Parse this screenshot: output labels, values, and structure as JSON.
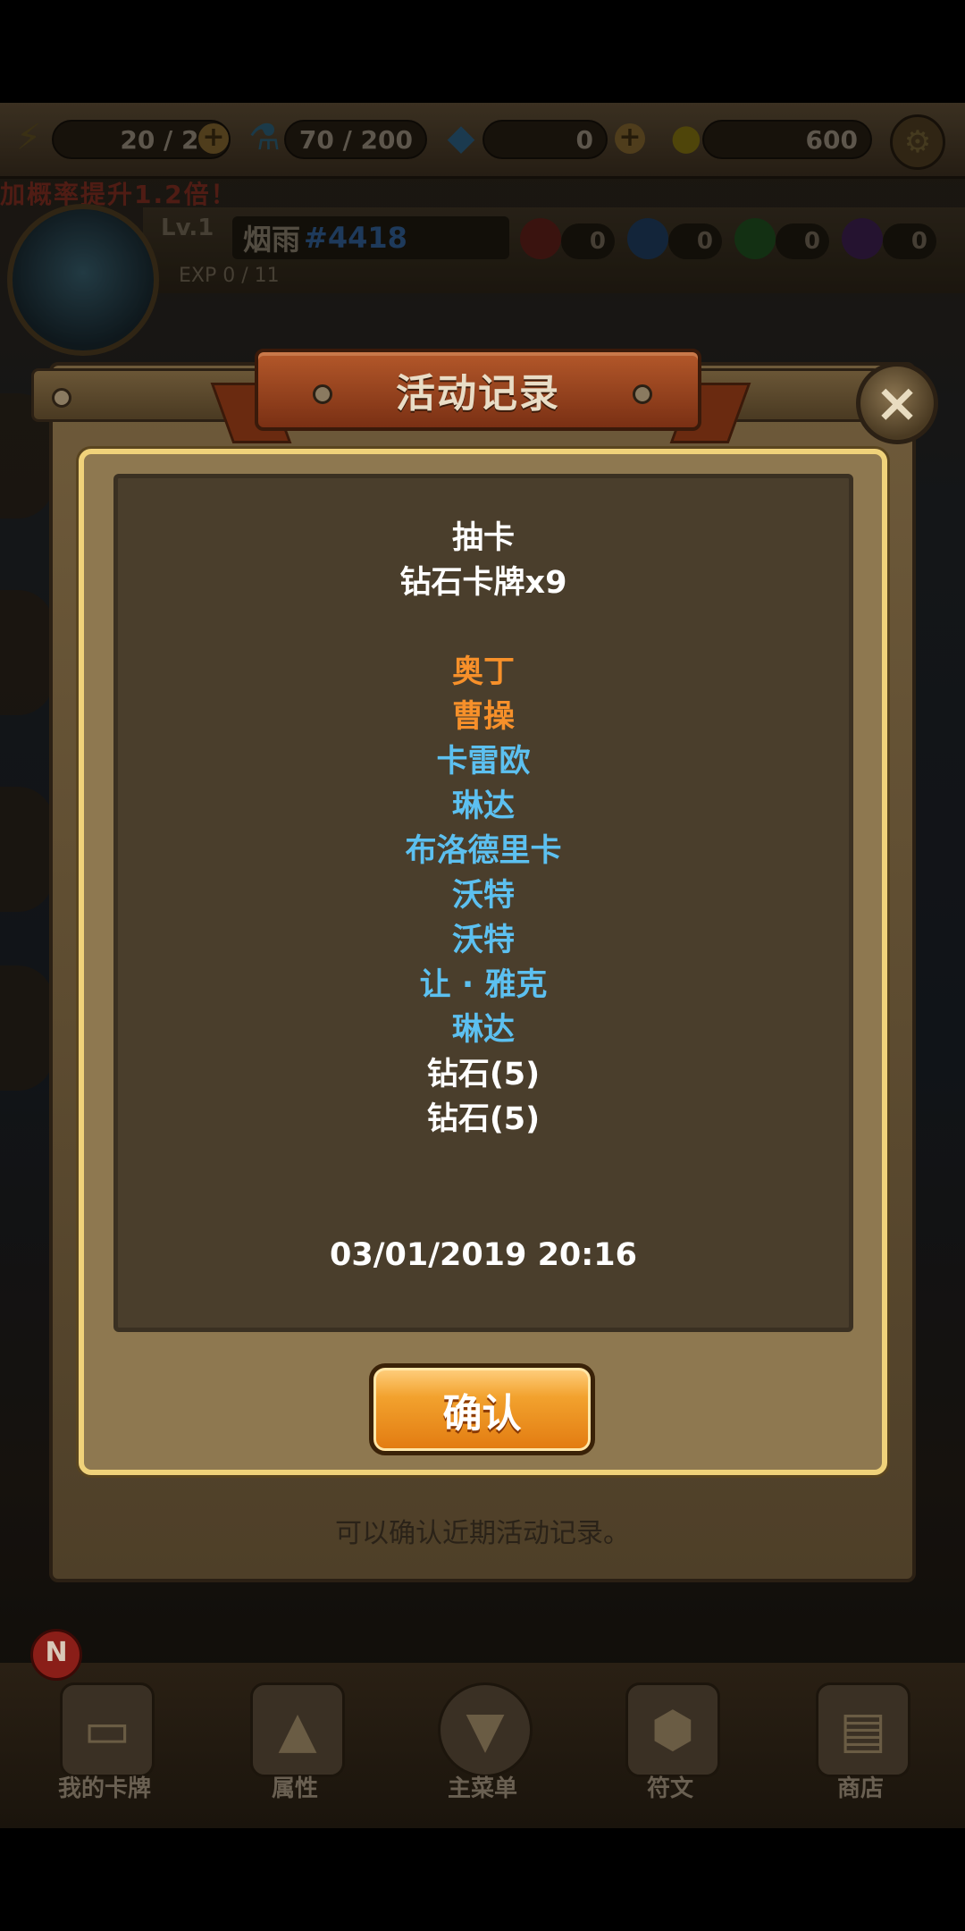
{
  "status": {
    "energy": "20 / 20",
    "potion": "70 / 200",
    "diamonds": "0",
    "gold": "600"
  },
  "banner": "加概率提升1.2倍！",
  "profile": {
    "level": "Lv.1",
    "exp": "EXP  0 / 11",
    "name": "烟雨",
    "tag": "#4418",
    "orbs": [
      {
        "color": "#b8332a",
        "value": "0"
      },
      {
        "color": "#3a78c8",
        "value": "0"
      },
      {
        "color": "#3aa83a",
        "value": "0"
      },
      {
        "color": "#8a3ab8",
        "value": "0"
      }
    ]
  },
  "dialog": {
    "title": "活动记录",
    "close_icon": "×",
    "record": {
      "type": "抽卡",
      "pack": "钻石卡牌x9",
      "items": [
        {
          "name": "奥丁",
          "rarity": "orange"
        },
        {
          "name": "曹操",
          "rarity": "orange"
        },
        {
          "name": "卡雷欧",
          "rarity": "blue"
        },
        {
          "name": "琳达",
          "rarity": "blue"
        },
        {
          "name": "布洛德里卡",
          "rarity": "blue"
        },
        {
          "name": "沃特",
          "rarity": "blue"
        },
        {
          "name": "沃特",
          "rarity": "blue"
        },
        {
          "name": "让 · 雅克",
          "rarity": "blue"
        },
        {
          "name": "琳达",
          "rarity": "blue"
        },
        {
          "name": "钻石(5)",
          "rarity": "white"
        },
        {
          "name": "钻石(5)",
          "rarity": "white"
        }
      ],
      "timestamp": "03/01/2019 20:16"
    },
    "confirm_label": "确认",
    "hint": "可以确认近期活动记录。"
  },
  "nav": {
    "badge": "N",
    "items": [
      {
        "label": "我的卡牌",
        "icon": "cards-icon"
      },
      {
        "label": "属性",
        "icon": "pyramid-icon"
      },
      {
        "label": "主菜单",
        "icon": "emblem-icon"
      },
      {
        "label": "符文",
        "icon": "rune-stone-icon"
      },
      {
        "label": "商店",
        "icon": "treasure-chest-icon"
      }
    ]
  },
  "colors": {
    "orange_rarity": "#f7902a",
    "blue_rarity": "#5cc0f0",
    "white_text": "#ffffff",
    "button_orange": "#e27a10",
    "frame_gold": "#f0d27a"
  }
}
